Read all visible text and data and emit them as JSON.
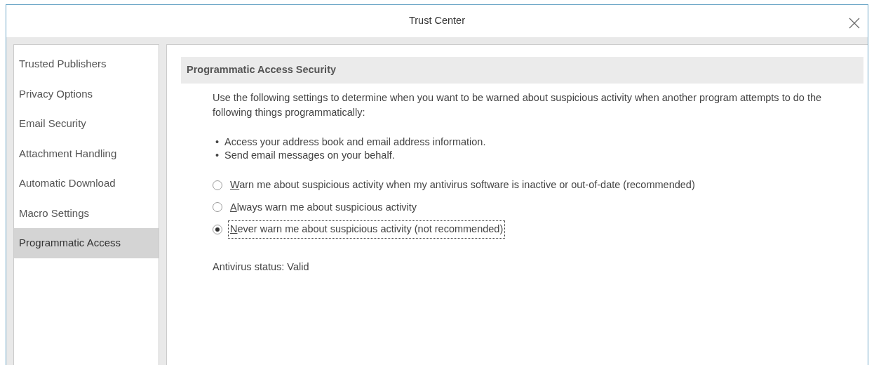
{
  "window": {
    "title": "Trust Center"
  },
  "sidebar": {
    "items": [
      {
        "label": "Trusted Publishers",
        "selected": false
      },
      {
        "label": "Privacy Options",
        "selected": false
      },
      {
        "label": "Email Security",
        "selected": false
      },
      {
        "label": "Attachment Handling",
        "selected": false
      },
      {
        "label": "Automatic Download",
        "selected": false
      },
      {
        "label": "Macro Settings",
        "selected": false
      },
      {
        "label": "Programmatic Access",
        "selected": true
      }
    ]
  },
  "section": {
    "title": "Programmatic Access Security",
    "description": "Use the following settings to determine when you want to be warned about suspicious activity when another program attempts to do the following things programmatically:",
    "bullets": [
      {
        "marker": "•",
        "text": "Access your address book and email address information."
      },
      {
        "marker": "•",
        "text": "Send email messages on your behalf."
      }
    ],
    "options": [
      {
        "label": "Warn me about suspicious activity when my antivirus software is inactive or out-of-date (recommended)",
        "selected": false,
        "focused": false
      },
      {
        "label": "Always warn me about suspicious activity",
        "selected": false,
        "focused": false
      },
      {
        "label": "Never warn me about suspicious activity (not recommended)",
        "selected": true,
        "focused": true
      }
    ],
    "status": "Antivirus status: Valid"
  }
}
